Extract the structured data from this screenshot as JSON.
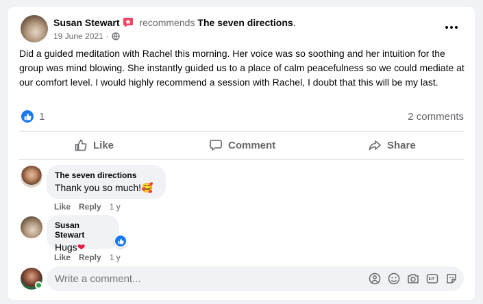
{
  "post": {
    "author": "Susan Stewart",
    "verb": "recommends",
    "page_name": "The seven directions",
    "period": ".",
    "date": "19 June 2021",
    "dot": "·",
    "text": "Did a guided meditation with Rachel this morning. Her voice was so soothing and her intuition for the group was mind blowing. She instantly guided us to a place of calm peacefulness so we could mediate at our comfort level. I would highly recommend a session with Rachel, I doubt that this will be my last.",
    "like_count": "1",
    "comments_count": "2 comments",
    "more_icon": "more-icon",
    "recommend_badge_icon": "recommend-badge-icon"
  },
  "actions": {
    "like": "Like",
    "comment": "Comment",
    "share": "Share"
  },
  "comments": [
    {
      "author": "The seven directions",
      "text": "Thank you so much!",
      "emoji": "🥰",
      "like": "Like",
      "reply": "Reply",
      "age": "1 y"
    },
    {
      "author": "Susan Stewart",
      "text": "Hugs",
      "emoji": "❤",
      "like": "Like",
      "reply": "Reply",
      "age": "1 y",
      "reaction_count": 1
    }
  ],
  "composer": {
    "placeholder": "Write a comment...",
    "icons": [
      "avatar-sticker-icon",
      "emoji-icon",
      "camera-icon",
      "gif-icon",
      "sticker-icon"
    ]
  },
  "colors": {
    "brand_blue": "#1877f2",
    "badge_red": "#f3425f",
    "online_green": "#31a24c",
    "muted_text": "#65676b"
  }
}
